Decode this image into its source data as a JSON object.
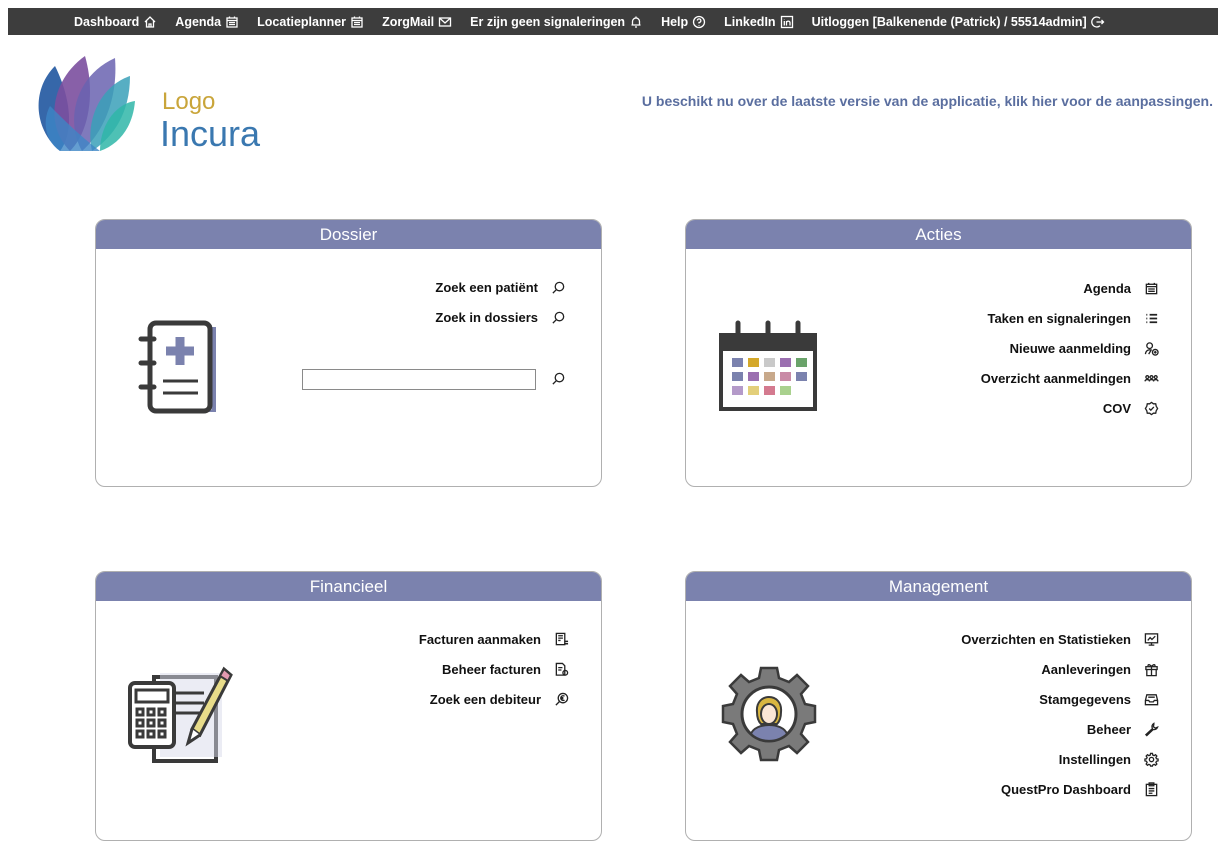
{
  "topnav": [
    {
      "label": "Dashboard",
      "icon": "home-icon"
    },
    {
      "label": "Agenda",
      "icon": "calendar-icon"
    },
    {
      "label": "Locatieplanner",
      "icon": "calendar-icon"
    },
    {
      "label": "ZorgMail",
      "icon": "mail-icon"
    },
    {
      "label": "Er zijn geen signaleringen",
      "icon": "bell-icon"
    },
    {
      "label": "Help",
      "icon": "help-icon"
    },
    {
      "label": "LinkedIn",
      "icon": "linkedin-icon"
    },
    {
      "label": "Uitloggen [Balkenende (Patrick) / 55514admin]",
      "icon": "logout-icon"
    }
  ],
  "logo": {
    "line1": "Logo",
    "line2": "Incura"
  },
  "notice": "U beschikt nu over de laatste versie van de applicatie, klik hier voor de aanpassingen.",
  "cards": {
    "dossier": {
      "title": "Dossier",
      "links": [
        {
          "label": "Zoek een patiënt",
          "icon": "search-icon"
        },
        {
          "label": "Zoek in dossiers",
          "icon": "search-icon"
        }
      ],
      "search_value": ""
    },
    "acties": {
      "title": "Acties",
      "links": [
        {
          "label": "Agenda",
          "icon": "calendar-icon"
        },
        {
          "label": "Taken en signaleringen",
          "icon": "task-list-icon"
        },
        {
          "label": "Nieuwe aanmelding",
          "icon": "user-add-icon"
        },
        {
          "label": "Overzicht aanmeldingen",
          "icon": "users-group-icon"
        },
        {
          "label": "COV",
          "icon": "verified-icon"
        }
      ]
    },
    "financieel": {
      "title": "Financieel",
      "links": [
        {
          "label": "Facturen aanmaken",
          "icon": "invoice-create-icon"
        },
        {
          "label": "Beheer facturen",
          "icon": "invoice-manage-icon"
        },
        {
          "label": "Zoek een debiteur",
          "icon": "debtor-search-icon"
        }
      ]
    },
    "management": {
      "title": "Management",
      "links": [
        {
          "label": "Overzichten en Statistieken",
          "icon": "chart-icon"
        },
        {
          "label": "Aanleveringen",
          "icon": "gift-icon"
        },
        {
          "label": "Stamgegevens",
          "icon": "inbox-icon"
        },
        {
          "label": "Beheer",
          "icon": "wrench-icon"
        },
        {
          "label": "Instellingen",
          "icon": "gear-icon"
        },
        {
          "label": "QuestPro Dashboard",
          "icon": "clipboard-icon"
        }
      ]
    }
  },
  "colors": {
    "header": "#7b82ae",
    "topbar": "#3d3d3d",
    "notice": "#5a6e9f"
  }
}
